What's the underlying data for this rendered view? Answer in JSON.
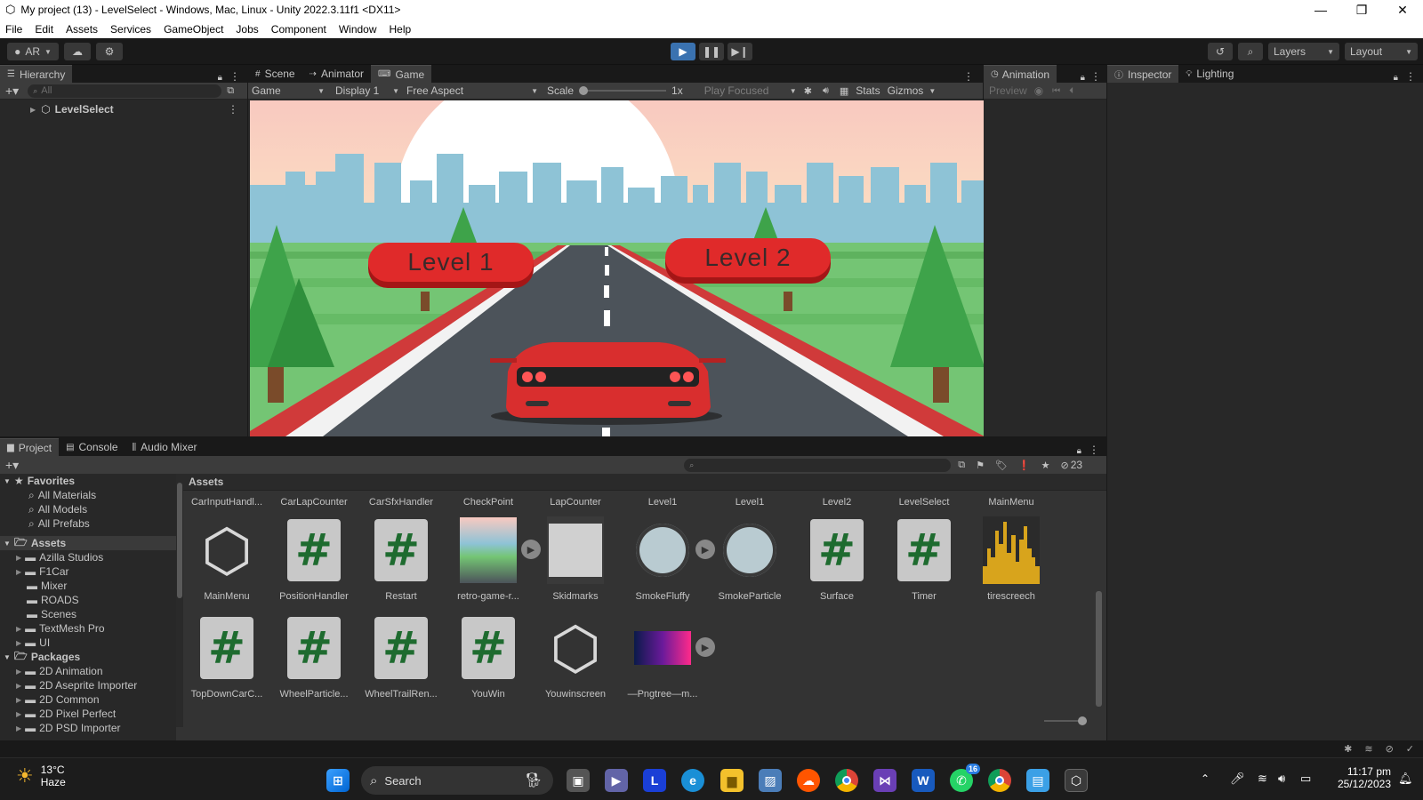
{
  "window": {
    "title": "My project (13) - LevelSelect - Windows, Mac, Linux - Unity 2022.3.11f1 <DX11>"
  },
  "menu": [
    "File",
    "Edit",
    "Assets",
    "Services",
    "GameObject",
    "Jobs",
    "Component",
    "Window",
    "Help"
  ],
  "toolbar": {
    "account": "AR",
    "layers": "Layers",
    "layout": "Layout"
  },
  "hierarchy": {
    "tab": "Hierarchy",
    "search_placeholder": "All",
    "root": "LevelSelect"
  },
  "center_tabs": [
    "Scene",
    "Animator",
    "Game"
  ],
  "game_toolbar": {
    "mode": "Game",
    "display": "Display 1",
    "aspect": "Free Aspect",
    "scale_label": "Scale",
    "scale_value": "1x",
    "play_focus": "Play Focused",
    "stats": "Stats",
    "gizmos": "Gizmos"
  },
  "game_view": {
    "button1": "Level 1",
    "button2": "Level 2"
  },
  "animation": {
    "tab": "Animation",
    "preview": "Preview"
  },
  "inspector": {
    "tab1": "Inspector",
    "tab2": "Lighting"
  },
  "bottom_tabs": [
    "Project",
    "Console",
    "Audio Mixer"
  ],
  "project": {
    "hidden_count": "23",
    "breadcrumb": "Assets",
    "tree": {
      "favorites": "Favorites",
      "fav_items": [
        "All Materials",
        "All Models",
        "All Prefabs"
      ],
      "assets": "Assets",
      "asset_folders": [
        "Azilla Studios",
        "F1Car",
        "Mixer",
        "ROADS",
        "Scenes",
        "TextMesh Pro",
        "UI"
      ],
      "packages": "Packages",
      "package_folders": [
        "2D Animation",
        "2D Aseprite Importer",
        "2D Common",
        "2D Pixel Perfect",
        "2D PSD Importer"
      ]
    },
    "top_row": [
      "CarInputHandl...",
      "CarLapCounter",
      "CarSfxHandler",
      "CheckPoint",
      "LapCounter",
      "Level1",
      "Level1",
      "Level2",
      "LevelSelect",
      "MainMenu"
    ],
    "row2": [
      {
        "label": "MainMenu",
        "kind": "unity"
      },
      {
        "label": "PositionHandler",
        "kind": "cs"
      },
      {
        "label": "Restart",
        "kind": "cs"
      },
      {
        "label": "retro-game-r...",
        "kind": "image"
      },
      {
        "label": "Skidmarks",
        "kind": "material"
      },
      {
        "label": "SmokeFluffy",
        "kind": "smoke"
      },
      {
        "label": "SmokeParticle",
        "kind": "smokemat"
      },
      {
        "label": "Surface",
        "kind": "cs"
      },
      {
        "label": "Timer",
        "kind": "cs"
      },
      {
        "label": "tirescreech",
        "kind": "audio"
      }
    ],
    "row3": [
      {
        "label": "TopDownCarC...",
        "kind": "cs"
      },
      {
        "label": "WheelParticle...",
        "kind": "cs"
      },
      {
        "label": "WheelTrailRen...",
        "kind": "cs"
      },
      {
        "label": "YouWin",
        "kind": "cs"
      },
      {
        "label": "Youwinscreen",
        "kind": "unity"
      },
      {
        "label": "—Pngtree—m...",
        "kind": "neon"
      }
    ]
  },
  "taskbar": {
    "weather_temp": "13°C",
    "weather_desc": "Haze",
    "search": "Search",
    "time": "11:17 pm",
    "date": "25/12/2023",
    "whatsapp_badge": "16"
  }
}
